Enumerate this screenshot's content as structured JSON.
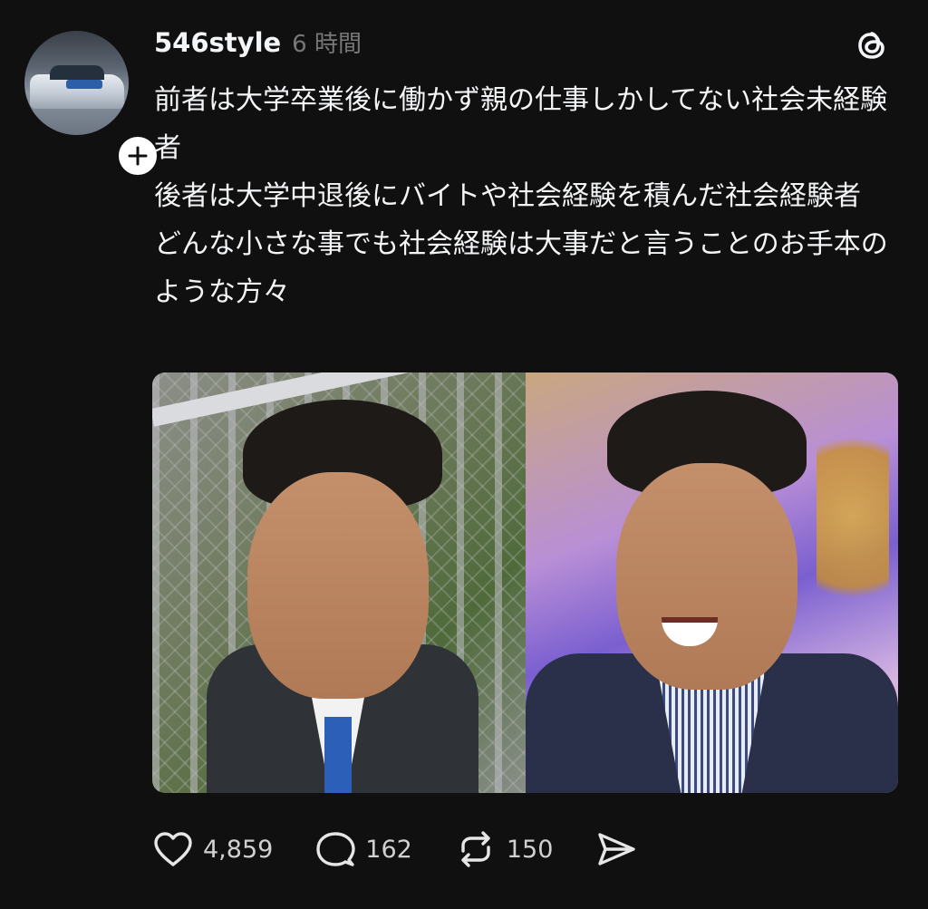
{
  "post": {
    "author": "546style",
    "timestamp": "6 時間",
    "paragraphs": [
      "前者は大学卒業後に働かず親の仕事しかしてない社会未経験者",
      "後者は大学中退後にバイトや社会経験を積んだ社会経験者",
      "どんな小さな事でも社会経験は大事だと言うことのお手本のような方々"
    ]
  },
  "actions": {
    "likes": "4,859",
    "replies": "162",
    "reposts": "150"
  },
  "icons": {
    "avatar": "avatar-photo-car",
    "follow": "plus-icon",
    "app": "threads-logo-icon",
    "like": "heart-icon",
    "reply": "speech-bubble-icon",
    "repost": "repost-arrows-icon",
    "share": "send-arrow-icon"
  },
  "colors": {
    "background": "#101010",
    "text": "#f3f5f7",
    "muted": "#777777"
  }
}
